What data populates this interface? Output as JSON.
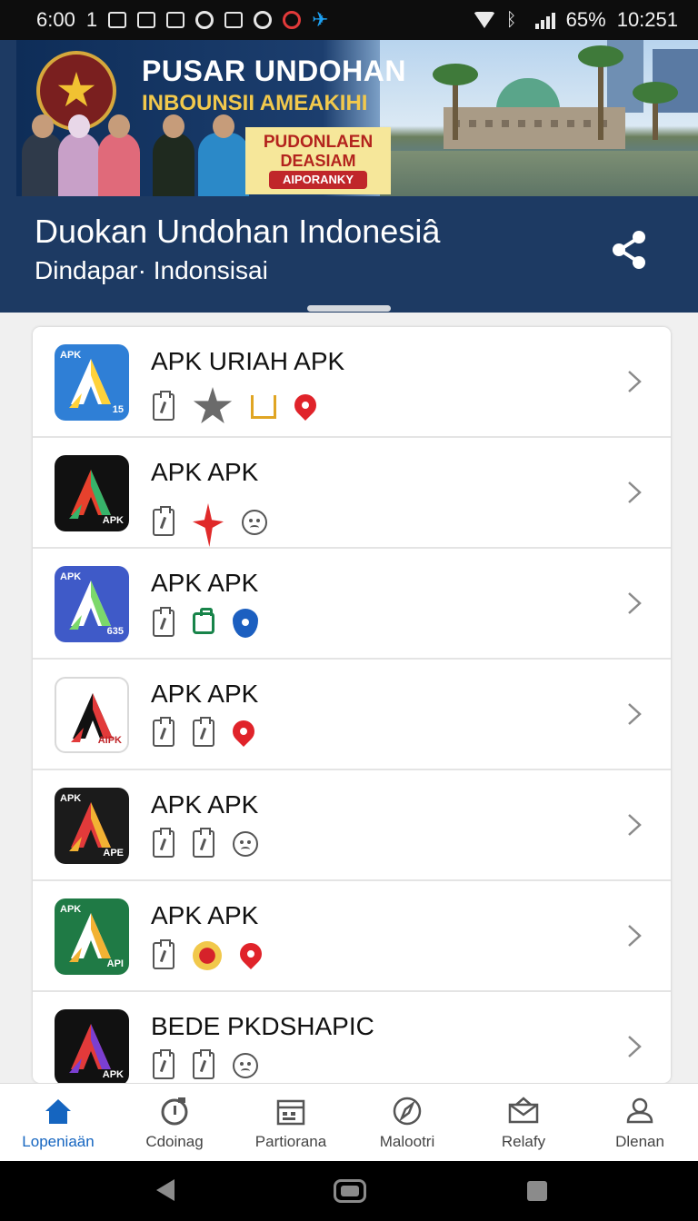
{
  "status_bar": {
    "time": "6:00",
    "notification_count": "1",
    "battery": "65%",
    "clock": "10:251"
  },
  "banner": {
    "title": "PUSAR UNDOHAN",
    "subtitle": "INBOUNSII AMEAKIHI",
    "promo_line1": "PUDONLAEN",
    "promo_line2": "DEASIAM",
    "promo_badge": "AIPORANKY"
  },
  "header": {
    "title": "Duokan Undohan Indonesiâ",
    "subtitle": "Dindapar· Indonsisai"
  },
  "apps": [
    {
      "name": "APK URIAH APK",
      "icon_label_tl": "APK",
      "icon_label_br": "15",
      "icon_bg": "#2f7fd6",
      "badges": [
        "clipboard-icon",
        "star-icon",
        "bars-icon",
        "pin-red-icon"
      ]
    },
    {
      "name": "APK APK",
      "icon_label_tl": "",
      "icon_label_br": "APK",
      "icon_bg": "#111111",
      "badges": [
        "clipboard-icon",
        "spark-icon",
        "face-icon"
      ]
    },
    {
      "name": "APK APK",
      "icon_label_tl": "APK",
      "icon_label_br": "635",
      "icon_bg": "#3f5ac8",
      "badges": [
        "clipboard-icon",
        "bag-icon",
        "shield-icon"
      ]
    },
    {
      "name": "APK APK",
      "icon_label_tl": "",
      "icon_label_br": "AIPK",
      "icon_bg": "#ffffff",
      "badges": [
        "clipboard-icon",
        "clipboard-icon",
        "pin-red-icon"
      ]
    },
    {
      "name": "APK APK",
      "icon_label_tl": "APK",
      "icon_label_br": "APE",
      "icon_bg": "#1b1b1b",
      "badges": [
        "clipboard-icon",
        "clipboard-icon",
        "face-icon"
      ]
    },
    {
      "name": "APK APK",
      "icon_label_tl": "APK",
      "icon_label_br": "API",
      "icon_bg": "#1f7a45",
      "badges": [
        "clipboard-icon",
        "dot-icon",
        "pin-red-icon"
      ]
    },
    {
      "name": "BEDE PKDSHAPIC",
      "icon_label_tl": "",
      "icon_label_br": "APK",
      "icon_bg": "#111111",
      "badges": [
        "clipboard-icon",
        "clipboard-icon",
        "face-icon"
      ]
    }
  ],
  "bottom_nav": [
    {
      "label": "Lopeniaän",
      "icon": "home-icon",
      "active": true
    },
    {
      "label": "Cdoinag",
      "icon": "refresh-icon",
      "active": false
    },
    {
      "label": "Partiorana",
      "icon": "calendar-icon",
      "active": false
    },
    {
      "label": "Malootri",
      "icon": "compass-icon",
      "active": false
    },
    {
      "label": "Relafy",
      "icon": "mail-icon",
      "active": false
    },
    {
      "label": "Dlenan",
      "icon": "profile-icon",
      "active": false
    }
  ],
  "colors": {
    "header_bg": "#1d3a63",
    "accent": "#1565c0",
    "pin_red": "#e0232a"
  }
}
